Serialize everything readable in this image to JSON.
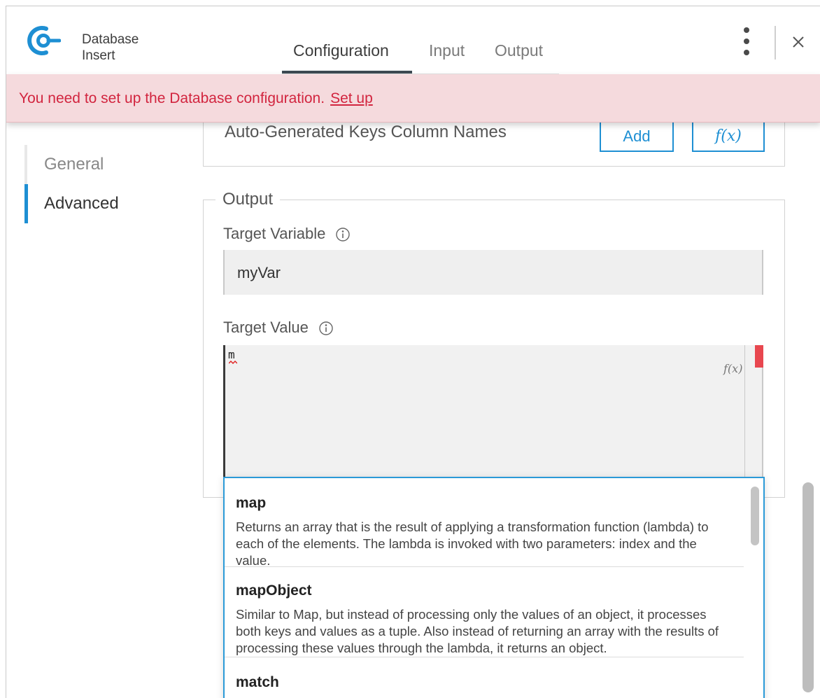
{
  "header": {
    "title_line1": "Database",
    "title_line2": "Insert",
    "tabs": [
      {
        "label": "Configuration",
        "active": true
      },
      {
        "label": "Input",
        "active": false
      },
      {
        "label": "Output",
        "active": false
      }
    ]
  },
  "alert": {
    "message": "You need to set up the Database configuration.",
    "link": "Set up"
  },
  "nav": {
    "items": [
      {
        "label": "General",
        "active": false
      },
      {
        "label": "Advanced",
        "active": true
      }
    ]
  },
  "upper_section": {
    "label": "Auto-Generated Keys Column Names",
    "add_button": "Add",
    "fx_button": "f(x)"
  },
  "output_section": {
    "legend": "Output",
    "target_variable_label": "Target Variable",
    "target_variable_value": "myVar",
    "target_value_label": "Target Value",
    "target_value_code": "m",
    "fx_label": "f(x)"
  },
  "autocomplete": {
    "items": [
      {
        "name": "map",
        "description": "Returns an array that is the result of applying a transformation function (lambda) to each of the elements. The lambda is invoked with two parameters: index and the value."
      },
      {
        "name": "mapObject",
        "description": "Similar to Map, but instead of processing only the values of an object, it processes both keys and values as a tuple. Also instead of returning an array with the results of processing these values through the lambda, it returns an object."
      },
      {
        "name": "match",
        "description": ""
      }
    ]
  },
  "colors": {
    "accent": "#1e8fd3",
    "alert_bg": "#f5dadd",
    "alert_text": "#d2253f",
    "error_marker": "#e8474f"
  }
}
